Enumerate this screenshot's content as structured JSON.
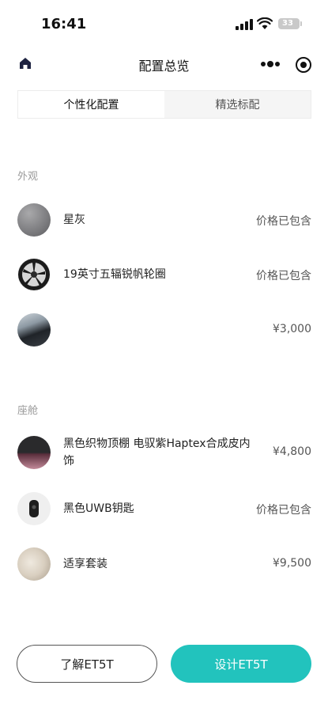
{
  "status_bar": {
    "time": "16:41",
    "battery": "33"
  },
  "nav": {
    "title": "配置总览"
  },
  "tabs": [
    {
      "label": "个性化配置",
      "active": true
    },
    {
      "label": "精选标配",
      "active": false
    }
  ],
  "sections": [
    {
      "title": "外观",
      "items": [
        {
          "name": "星灰",
          "price": "价格已包含"
        },
        {
          "name": "19英寸五辐锐帆轮圈",
          "price": "价格已包含"
        },
        {
          "name": "",
          "price": "¥3,000"
        }
      ]
    },
    {
      "title": "座舱",
      "items": [
        {
          "name": "黑色织物顶棚 电驭紫Haptex合成皮内饰",
          "price": "¥4,800"
        },
        {
          "name": "黑色UWB钥匙",
          "price": "价格已包含"
        },
        {
          "name": "适享套装",
          "price": "¥9,500"
        }
      ]
    }
  ],
  "buttons": {
    "learn": "了解ET5T",
    "design": "设计ET5T"
  },
  "colors": {
    "accent": "#22c3bd",
    "section_title": "#9a9a9a"
  }
}
